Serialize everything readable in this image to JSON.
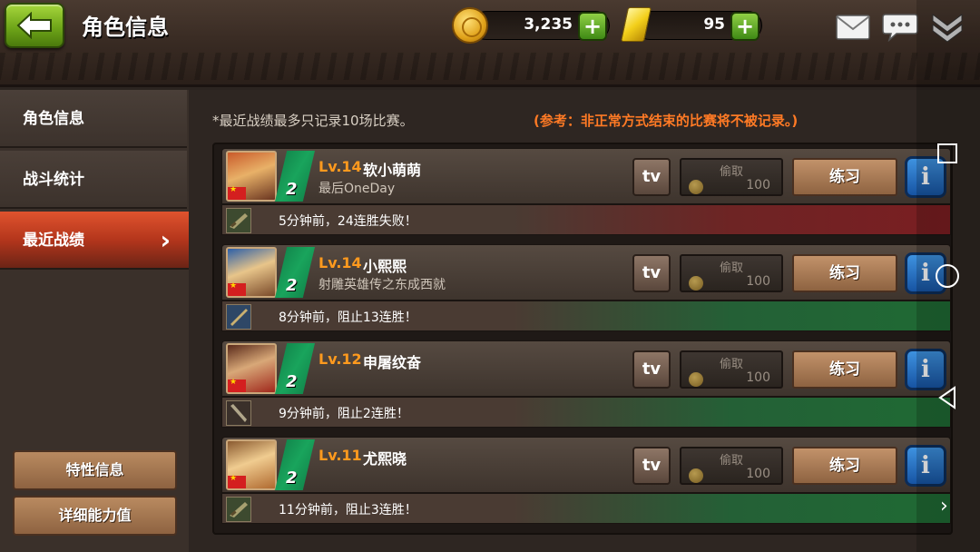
{
  "header": {
    "title": "角色信息",
    "coins": "3,235",
    "gold": "95"
  },
  "sidebar": {
    "items": [
      {
        "label": "角色信息"
      },
      {
        "label": "战斗统计"
      },
      {
        "label": "最近战绩"
      }
    ],
    "buttons": [
      {
        "label": "特性信息"
      },
      {
        "label": "详细能力值"
      }
    ]
  },
  "main": {
    "note_left": "*最近战绩最多只记录10场比赛。",
    "note_right": "(参考：非正常方式结束的比赛将不被记录。)",
    "rows": [
      {
        "lv": "Lv.14",
        "name": "软小萌萌",
        "subtitle": "最后OneDay",
        "rank": "2",
        "tv": "tv",
        "steal_label": "偷取",
        "steal_cost": "100",
        "practice": "练习",
        "info": "i",
        "result": "5分钟前，24连胜失败！",
        "outcome": "lose"
      },
      {
        "lv": "Lv.14",
        "name": "小熙熙",
        "subtitle": "射雕英雄传之东成西就",
        "rank": "2",
        "tv": "tv",
        "steal_label": "偷取",
        "steal_cost": "100",
        "practice": "练习",
        "info": "i",
        "result": "8分钟前，阻止13连胜！",
        "outcome": "win"
      },
      {
        "lv": "Lv.12",
        "name": "申屠纹奋",
        "subtitle": "",
        "rank": "2",
        "tv": "tv",
        "steal_label": "偷取",
        "steal_cost": "100",
        "practice": "练习",
        "info": "i",
        "result": "9分钟前，阻止2连胜！",
        "outcome": "win"
      },
      {
        "lv": "Lv.11",
        "name": "尤熙晓",
        "subtitle": "",
        "rank": "2",
        "tv": "tv",
        "steal_label": "偷取",
        "steal_cost": "100",
        "practice": "练习",
        "info": "i",
        "result": "11分钟前，阻止3连胜！",
        "outcome": "win"
      }
    ]
  },
  "icons": {
    "back": "back-arrow-icon",
    "coin": "coin-icon",
    "gold": "gold-bar-icon",
    "mail": "mail-icon",
    "chat": "chat-icon",
    "menu": "chevron-double-down-icon"
  },
  "colors": {
    "accent_orange": "#ff9a1e",
    "active_tab": "#c8401f",
    "lose_band": "#7a1e22",
    "win_band": "#1f6a34",
    "info_blue": "#1f6ac0"
  }
}
